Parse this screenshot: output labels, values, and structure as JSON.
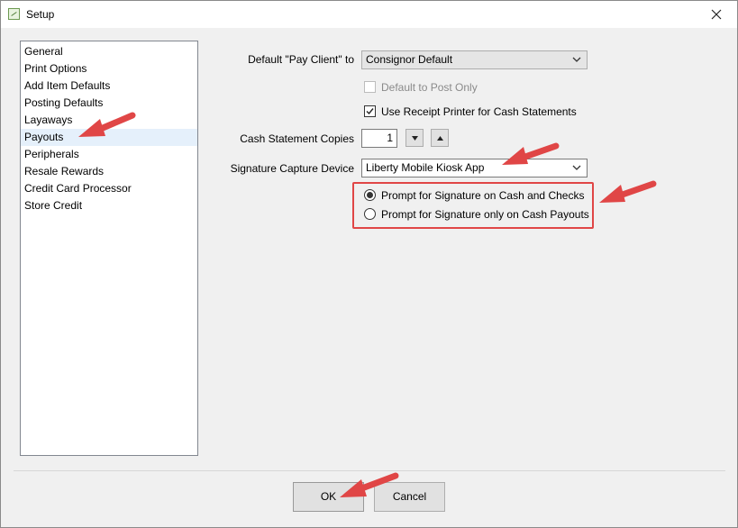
{
  "window": {
    "title": "Setup"
  },
  "nav": {
    "items": [
      {
        "label": "General"
      },
      {
        "label": "Print Options"
      },
      {
        "label": "Add Item Defaults"
      },
      {
        "label": "Posting Defaults"
      },
      {
        "label": "Layaways"
      },
      {
        "label": "Payouts",
        "selected": true
      },
      {
        "label": "Peripherals"
      },
      {
        "label": "Resale Rewards"
      },
      {
        "label": "Credit Card Processor"
      },
      {
        "label": "Store Credit"
      }
    ]
  },
  "form": {
    "pay_client_label": "Default \"Pay Client\" to",
    "pay_client_value": "Consignor Default",
    "default_to_post_only_label": "Default to Post Only",
    "default_to_post_only_checked": false,
    "use_receipt_printer_label": "Use Receipt Printer for Cash Statements",
    "use_receipt_printer_checked": true,
    "cash_copies_label": "Cash Statement Copies",
    "cash_copies_value": "1",
    "signature_device_label": "Signature Capture Device",
    "signature_device_value": "Liberty Mobile Kiosk App",
    "radio_cash_checks_label": "Prompt for Signature on Cash and Checks",
    "radio_cash_payouts_label": "Prompt for Signature only on Cash Payouts",
    "selected_radio": "cash_checks"
  },
  "buttons": {
    "ok": "OK",
    "cancel": "Cancel"
  },
  "colors": {
    "annotation_red": "#e04646",
    "selection": "#e5f0fb"
  }
}
